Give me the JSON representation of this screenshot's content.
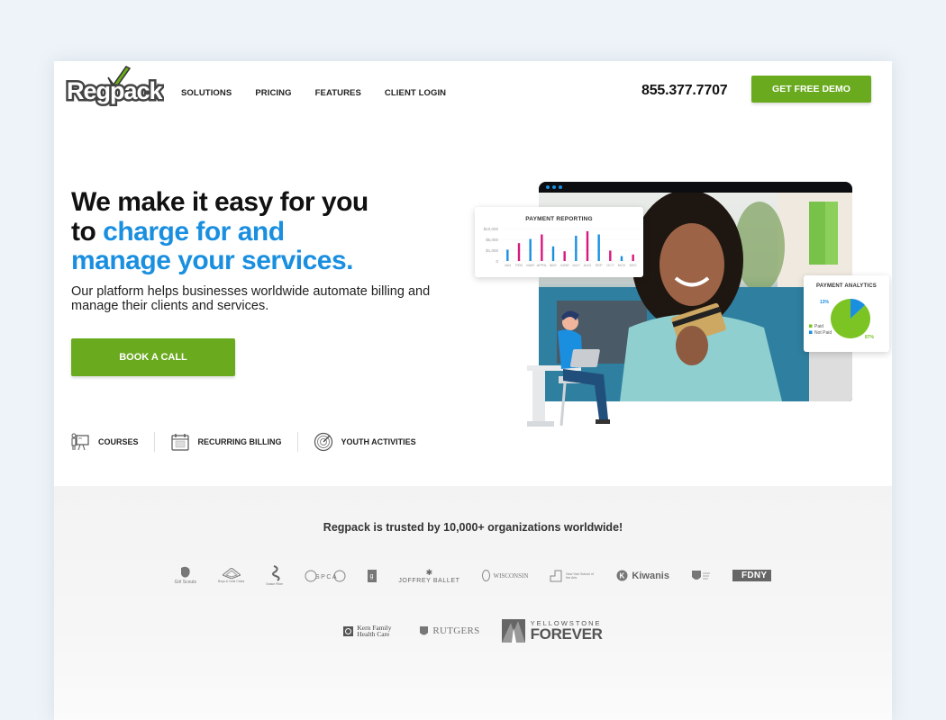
{
  "header": {
    "logo_text": "Regpack",
    "nav": [
      "SOLUTIONS",
      "PRICING",
      "FEATURES",
      "CLIENT LOGIN"
    ],
    "phone": "855.377.7707",
    "cta": "GET FREE DEMO"
  },
  "hero": {
    "headline_line1": "We make it easy for you",
    "headline_line2_dark": "to ",
    "headline_line2_blue": "charge for and",
    "headline_line3_blue": "manage your services.",
    "subtext": "Our platform helps businesses worldwide automate billing and manage their clients and services.",
    "cta": "BOOK A CALL",
    "features": [
      {
        "label": "COURSES",
        "icon": "presentation-icon"
      },
      {
        "label": "RECURRING BILLING",
        "icon": "calendar-icon"
      },
      {
        "label": "YOUTH ACTIVITIES",
        "icon": "target-icon"
      }
    ]
  },
  "illustration": {
    "payment_reporting": {
      "title": "PAYMENT REPORTING",
      "y_ticks": [
        "$10,000",
        "$5,000",
        "$1,000",
        "0"
      ],
      "months": [
        "JAN",
        "FEB",
        "MAR",
        "APRIL",
        "MAY",
        "JUNE",
        "JULY",
        "AUG",
        "SEP",
        "OCT",
        "NOV",
        "DEC"
      ],
      "values": [
        0.35,
        0.55,
        0.68,
        0.82,
        0.45,
        0.3,
        0.78,
        0.92,
        0.82,
        0.32,
        0.15,
        0.2
      ],
      "colors": [
        "#1a8fe0",
        "#d6197f",
        "#1a8fe0",
        "#d6197f",
        "#1a8fe0",
        "#d6197f",
        "#1a8fe0",
        "#d6197f",
        "#1a8fe0",
        "#d6197f",
        "#1a8fe0",
        "#d6197f"
      ]
    },
    "payment_analytics": {
      "title": "PAYMENT ANALYTICS",
      "slices": [
        {
          "label": "Paid",
          "percent": 87,
          "color": "#7cc423"
        },
        {
          "label": "Not Paid",
          "percent": 13,
          "color": "#1a8fe0"
        }
      ],
      "paid_label": "87%",
      "not_paid_label": "13%"
    }
  },
  "trusted": {
    "title": "Regpack is trusted by 10,000+ organizations worldwide!",
    "row1": [
      "Girl Scouts",
      "Boys & Girls Clubs",
      "Snake River",
      "East Bay SPCA",
      "Goodwill",
      "JOFFREY BALLET",
      "WISCONSIN",
      "New York School of the Arts",
      "Kiwanis",
      "Salvation Army",
      "FDNY"
    ],
    "row2": [
      "Kern Family Health Care",
      "RUTGERS",
      "YELLOWSTONE",
      "FOREVER"
    ]
  },
  "colors": {
    "brand_green": "#6aaa1f",
    "accent_blue": "#1a8fe0",
    "magenta": "#d6197f"
  }
}
